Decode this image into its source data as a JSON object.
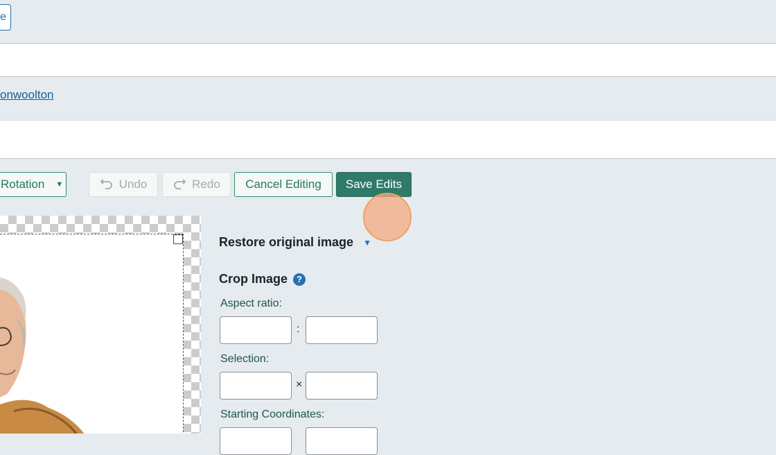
{
  "top": {
    "button_label": "e"
  },
  "author": {
    "link_text": "onwoolton"
  },
  "toolbar": {
    "rotation_label": "Rotation",
    "rotation_caret": "▼",
    "undo_label": "Undo",
    "redo_label": "Redo",
    "cancel_label": "Cancel Editing",
    "save_label": "Save Edits"
  },
  "panel": {
    "restore_heading": "Restore original image",
    "restore_caret": "▼",
    "crop_heading": "Crop Image",
    "help_glyph": "?",
    "aspect_label": "Aspect ratio:",
    "aspect_sep": ":",
    "aspect_width": "",
    "aspect_height": "",
    "selection_label": "Selection:",
    "selection_sep": "×",
    "selection_width": "",
    "selection_height": "",
    "coords_label": "Starting Coordinates:"
  },
  "colors": {
    "page_bg": "#e5ebef",
    "accent": "#2f7a69",
    "link": "#135e96",
    "click_indicator": "#f6aa82"
  },
  "icons": [
    "undo-icon",
    "redo-icon",
    "help-icon",
    "caret-down-icon"
  ]
}
